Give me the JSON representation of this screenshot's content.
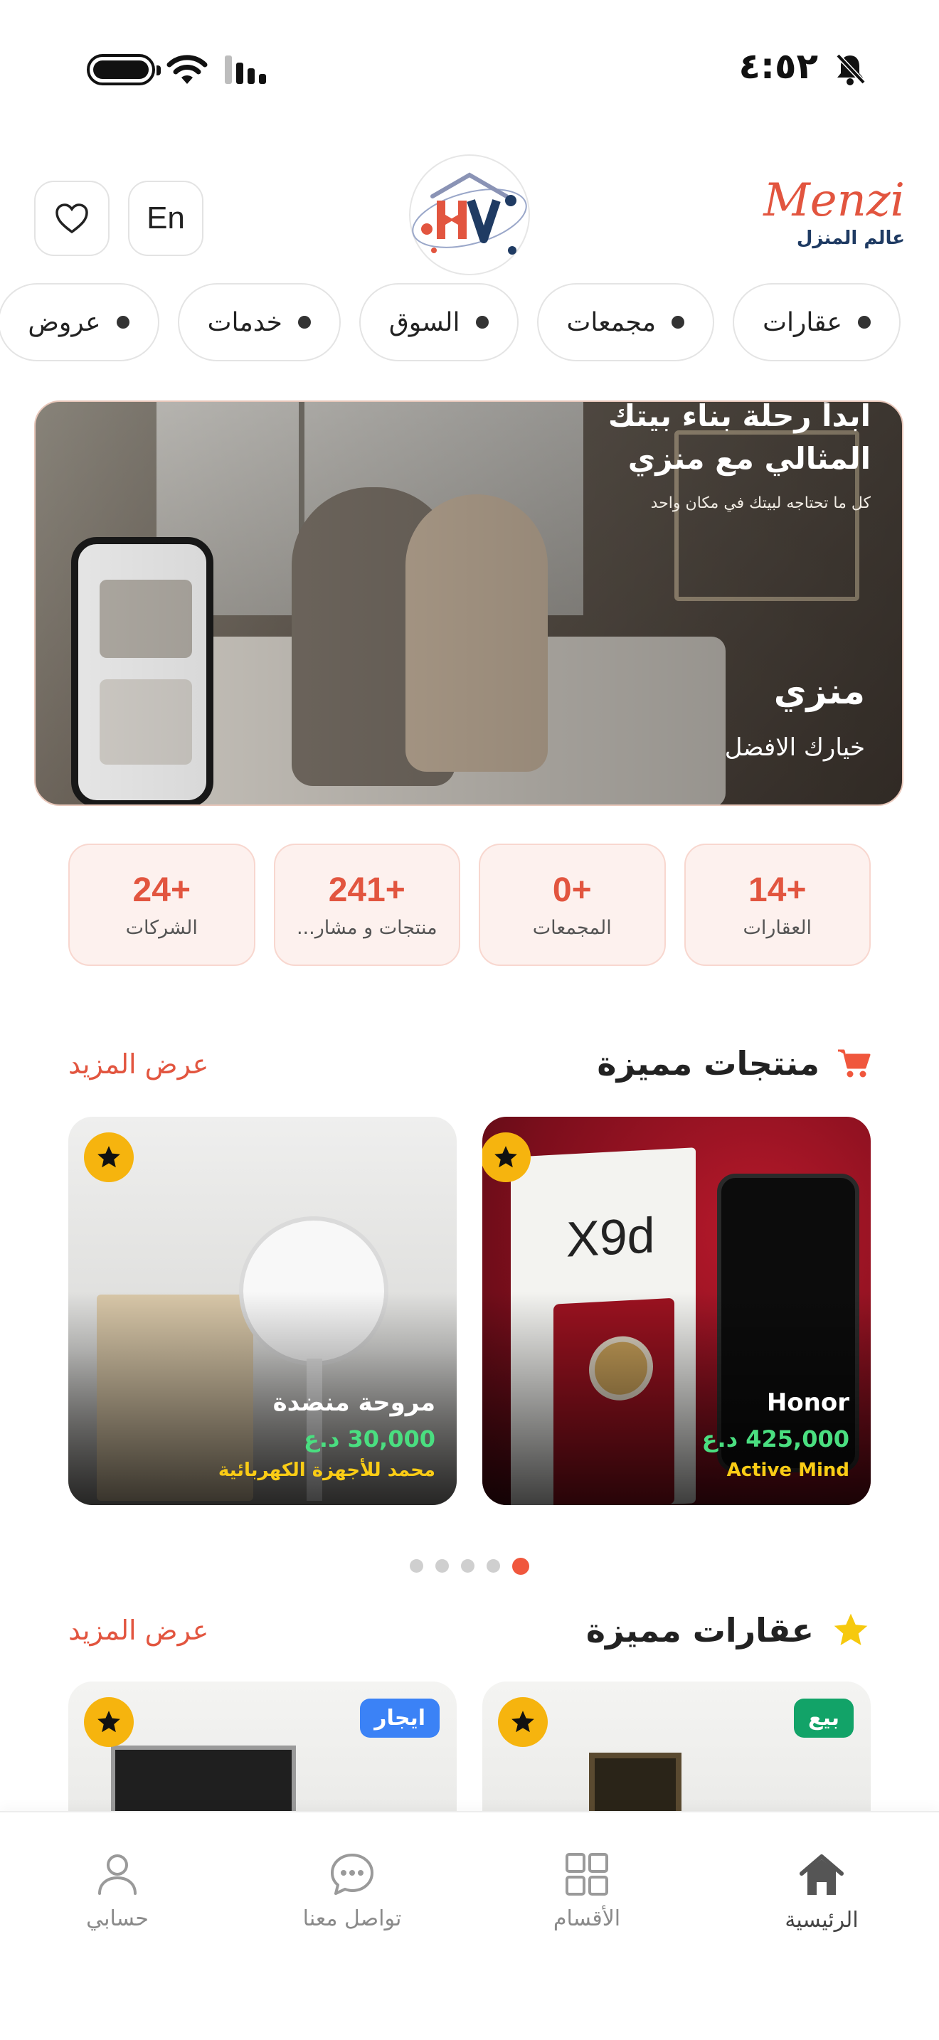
{
  "status_bar": {
    "time": "٤:٥٢"
  },
  "header": {
    "lang_button": "En",
    "brand_name": "Menzi",
    "brand_sub": "عالم المنزل"
  },
  "chips": [
    "عقارات",
    "مجمعات",
    "السوق",
    "خدمات",
    "عروض"
  ],
  "hero": {
    "headline": "ابدأ رحلة بناء بيتك المثالي مع منزي",
    "subline": "كل ما تحتاجه لبيتك في مكان واحد",
    "title": "منزي",
    "tagline": "خيارك الافضل"
  },
  "stats": [
    {
      "value": "+14",
      "label": "العقارات"
    },
    {
      "value": "+0",
      "label": "المجمعات"
    },
    {
      "value": "+241",
      "label": "منتجات و مشار..."
    },
    {
      "value": "+24",
      "label": "الشركات"
    }
  ],
  "featured_products": {
    "title": "منتجات مميزة",
    "see_more": "عرض المزيد",
    "items": [
      {
        "name": "Honor",
        "price": "425,000 د.ع",
        "store": "Active Mind"
      },
      {
        "name": "مروحة منضدة",
        "price": "30,000 د.ع",
        "store": "محمد للأجهزة الكهربائية"
      }
    ],
    "pager_count": 5,
    "pager_active": 1
  },
  "featured_properties": {
    "title": "عقارات مميزة",
    "see_more": "عرض المزيد",
    "items": [
      {
        "tag": "بيع"
      },
      {
        "tag": "ايجار"
      }
    ]
  },
  "bottom_nav": [
    {
      "label": "الرئيسية",
      "icon": "home-icon",
      "active": true
    },
    {
      "label": "الأقسام",
      "icon": "grid-icon",
      "active": false
    },
    {
      "label": "تواصل معنا",
      "icon": "chat-icon",
      "active": false
    },
    {
      "label": "حسابي",
      "icon": "user-icon",
      "active": false
    }
  ],
  "colors": {
    "accent": "#e2553f",
    "star": "#f6b40e",
    "price": "#4ade80",
    "store": "#facc15",
    "sale_tag": "#12a368",
    "rent_tag": "#3b82f6"
  }
}
